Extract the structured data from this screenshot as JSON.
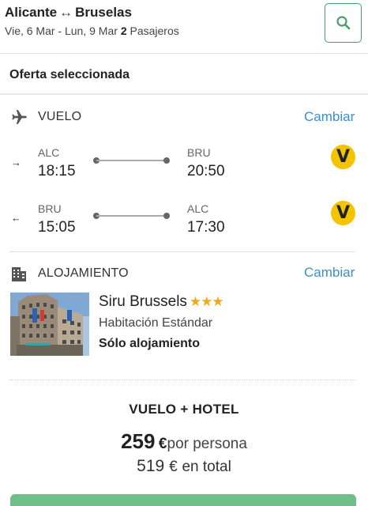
{
  "header": {
    "origin": "Alicante",
    "route_arrow": "↔",
    "destination": "Bruselas",
    "dates": "Vie, 6 Mar - Lun, 9 Mar",
    "passengers_count": "2",
    "passengers_label": "Pasajeros",
    "search_icon": "search-icon"
  },
  "offer": {
    "title": "Oferta seleccionada"
  },
  "flight": {
    "section_title": "VUELO",
    "change_label": "Cambiar",
    "outbound": {
      "direction": "→",
      "from_code": "ALC",
      "from_time": "18:15",
      "to_code": "BRU",
      "to_time": "20:50",
      "airline_logo": "V"
    },
    "return": {
      "direction": "←",
      "from_code": "BRU",
      "from_time": "15:05",
      "to_code": "ALC",
      "to_time": "17:30",
      "airline_logo": "V"
    }
  },
  "hotel": {
    "section_title": "ALOJAMIENTO",
    "change_label": "Cambiar",
    "name": "Siru Brussels",
    "stars": "★★★",
    "star_count": 3,
    "room": "Habitación Estándar",
    "board": "Sólo alojamiento"
  },
  "summary": {
    "package": "VUELO + HOTEL",
    "price_per_person": "259",
    "currency": "€",
    "per_person_label": "por persona",
    "total_price": "519",
    "total_label": "en total"
  },
  "colors": {
    "accent_green": "#46a06c",
    "link_blue": "#3b8fc8",
    "star": "#f2a81d",
    "airline_yellow": "#f5c400",
    "cta_green": "#6fbf8b"
  }
}
